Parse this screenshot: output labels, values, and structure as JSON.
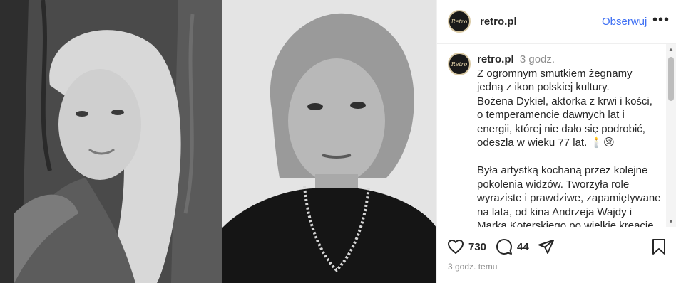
{
  "post": {
    "username": "retro.pl",
    "avatar_text": "Retro",
    "follow_label": "Obserwuj",
    "more_label": "•••",
    "caption": {
      "username": "retro.pl",
      "time": "3 godz.",
      "text": "Z ogromnym smutkiem żegnamy jedną z ikon polskiej kultury.\nBożena Dykiel, aktorka z krwi i kości, o temperamencie dawnych lat i energii, której nie dało się podrobić, odeszła w wieku 77 lat. 🕯️😢\n\nByła artystką kochaną przez kolejne pokolenia widzów. Tworzyła role wyraziste i prawdziwe, zapamiętywane na lata, od kina Andrzeja Wajdy i Marka Koterskiego po wielkie kreacje teatralne. Jej Genlene w „Balladynie”"
    },
    "likes": "730",
    "comments_count": "44",
    "timestamp": "3 godz. temu"
  },
  "colors": {
    "accent": "#3d6ff4",
    "muted": "#8e8e8e",
    "text": "#262626"
  },
  "icons": {
    "like": "heart-icon",
    "comment": "comment-icon",
    "share": "share-icon",
    "save": "bookmark-icon",
    "more": "more-icon"
  }
}
